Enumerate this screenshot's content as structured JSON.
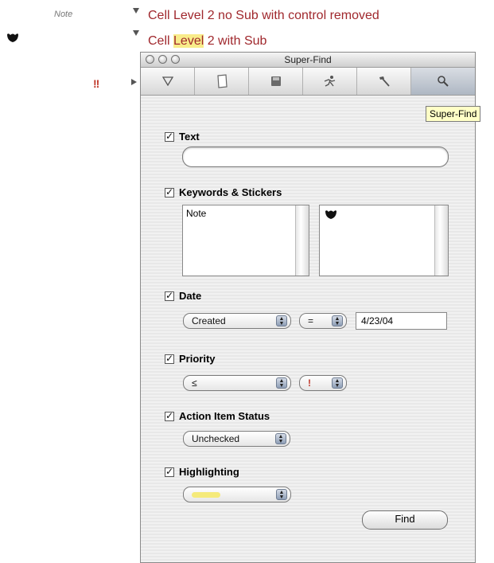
{
  "outline": {
    "note_tag": "Note",
    "row1_text": "Cell Level 2 no Sub with control removed",
    "row2_before": "Cell ",
    "row2_highlight": "Level",
    "row2_after": " 2 with Sub",
    "priority_marks": "!!"
  },
  "window": {
    "title": "Super-Find",
    "tooltip": "Super-Find"
  },
  "toolbar": {
    "items": [
      {
        "name": "filter",
        "icon": "funnel-icon"
      },
      {
        "name": "note",
        "icon": "note-icon"
      },
      {
        "name": "save",
        "icon": "disk-icon"
      },
      {
        "name": "run",
        "icon": "runner-icon"
      },
      {
        "name": "hammer",
        "icon": "hammer-icon"
      },
      {
        "name": "find",
        "icon": "magnifier-icon",
        "active": true
      }
    ]
  },
  "form": {
    "text": {
      "label": "Text",
      "value": ""
    },
    "keywords": {
      "label": "Keywords & Stickers",
      "keywords": [
        "Note"
      ]
    },
    "date": {
      "label": "Date",
      "field": "Created",
      "operator": "=",
      "value": "4/23/04"
    },
    "priority": {
      "label": "Priority",
      "operator": "≤",
      "value": "!"
    },
    "action": {
      "label": "Action Item Status",
      "value": "Unchecked"
    },
    "highlighting": {
      "label": "Highlighting",
      "color": "#f5ea7a"
    },
    "find_button": "Find"
  },
  "colors": {
    "cell_text": "#a0282d",
    "highlight": "#f8ec8a",
    "priority": "#c0392b"
  }
}
